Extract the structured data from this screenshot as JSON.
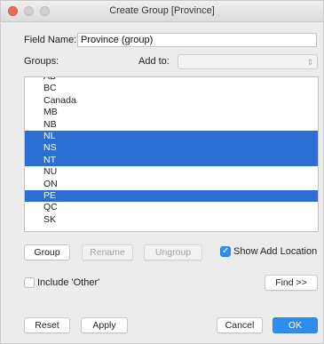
{
  "window": {
    "title": "Create Group [Province]"
  },
  "field_name": {
    "label": "Field Name:",
    "value": "Province (group)"
  },
  "groups_label": "Groups:",
  "add_to": {
    "label": "Add to:",
    "value": ""
  },
  "list": {
    "items": [
      {
        "label": "AB",
        "selected": false
      },
      {
        "label": "BC",
        "selected": false
      },
      {
        "label": "Canada",
        "selected": false
      },
      {
        "label": "MB",
        "selected": false
      },
      {
        "label": "NB",
        "selected": false
      },
      {
        "label": "NL",
        "selected": true
      },
      {
        "label": "NS",
        "selected": true
      },
      {
        "label": "NT",
        "selected": true
      },
      {
        "label": "NU",
        "selected": false
      },
      {
        "label": "ON",
        "selected": false
      },
      {
        "label": "PE",
        "selected": true
      },
      {
        "label": "QC",
        "selected": false
      },
      {
        "label": "SK",
        "selected": false
      }
    ]
  },
  "buttons": {
    "group": "Group",
    "rename": "Rename",
    "ungroup": "Ungroup",
    "show_add_location": "Show Add Location",
    "include_other": "Include 'Other'",
    "find": "Find >>",
    "reset": "Reset",
    "apply": "Apply",
    "cancel": "Cancel",
    "ok": "OK"
  },
  "checkboxes": {
    "show_add_location": true,
    "include_other": false
  },
  "colors": {
    "selection": "#2b6fd4",
    "primary": "#2d8ef0",
    "close": "#ec6a5f"
  }
}
